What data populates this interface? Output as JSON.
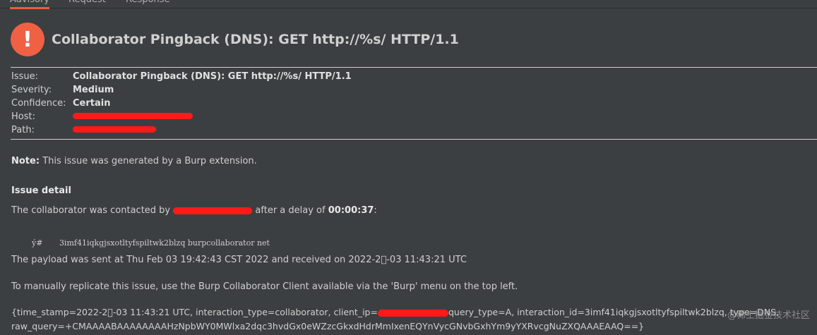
{
  "tabs": [
    {
      "label": "Advisory",
      "active": true
    },
    {
      "label": "Request",
      "active": false
    },
    {
      "label": "Response",
      "active": false
    }
  ],
  "header": {
    "icon": "exclamation-icon",
    "icon_glyph": "!",
    "title": "Collaborator Pingback (DNS): GET http://%s/ HTTP/1.1"
  },
  "details": {
    "issue_label": "Issue:",
    "issue_value": "Collaborator Pingback (DNS): GET http://%s/ HTTP/1.1",
    "severity_label": "Severity:",
    "severity_value": "Medium",
    "confidence_label": "Confidence:",
    "confidence_value": "Certain",
    "host_label": "Host:",
    "path_label": "Path:"
  },
  "note": {
    "label": "Note:",
    "text": "This issue was generated by a Burp extension."
  },
  "issue_detail": {
    "heading": "Issue detail",
    "contacted_prefix": "The collaborator was contacted by",
    "contacted_middle": "after a delay of",
    "delay": "00:00:37",
    "contacted_suffix": ":",
    "dns_prefix": "ý#",
    "dns_query": "3imf41iqkgjsxotltyfspiltwk2blzq  burpcollaborator  net",
    "sent_line": "The payload was sent at Thu Feb 03 19:42:43 CST 2022 and received on 2022-2\u0000-03 11:43:21 UTC",
    "replicate_line": "To manually replicate this issue, use the Burp Collaborator Client available via the 'Burp' menu on the top left.",
    "raw_line1_a": "{time_stamp=2022-2\u0000-03 11:43:21 UTC, interaction_type=collaborator, client_ip=",
    "raw_line1_b": "query_type=A, interaction_id=3imf41iqkgjsxotltyfspiltwk2blzq, type=DNS,",
    "raw_line2": "raw_query=+CMAAAABAAAAAAAAHzNpbWY0MWlxa2dqc3hvdGx0eWZzcGkxdHdrMmIxenEQYnVycGNvbGxhYm9yYXRvcgNuZXQAAAEAAQ==}"
  },
  "watermark": "@稀土掘金技术社区",
  "colors": {
    "background": "#3c3f41",
    "alert": "#f06043",
    "redaction": "#ff1a1a",
    "active_tab": "#e8613b"
  }
}
